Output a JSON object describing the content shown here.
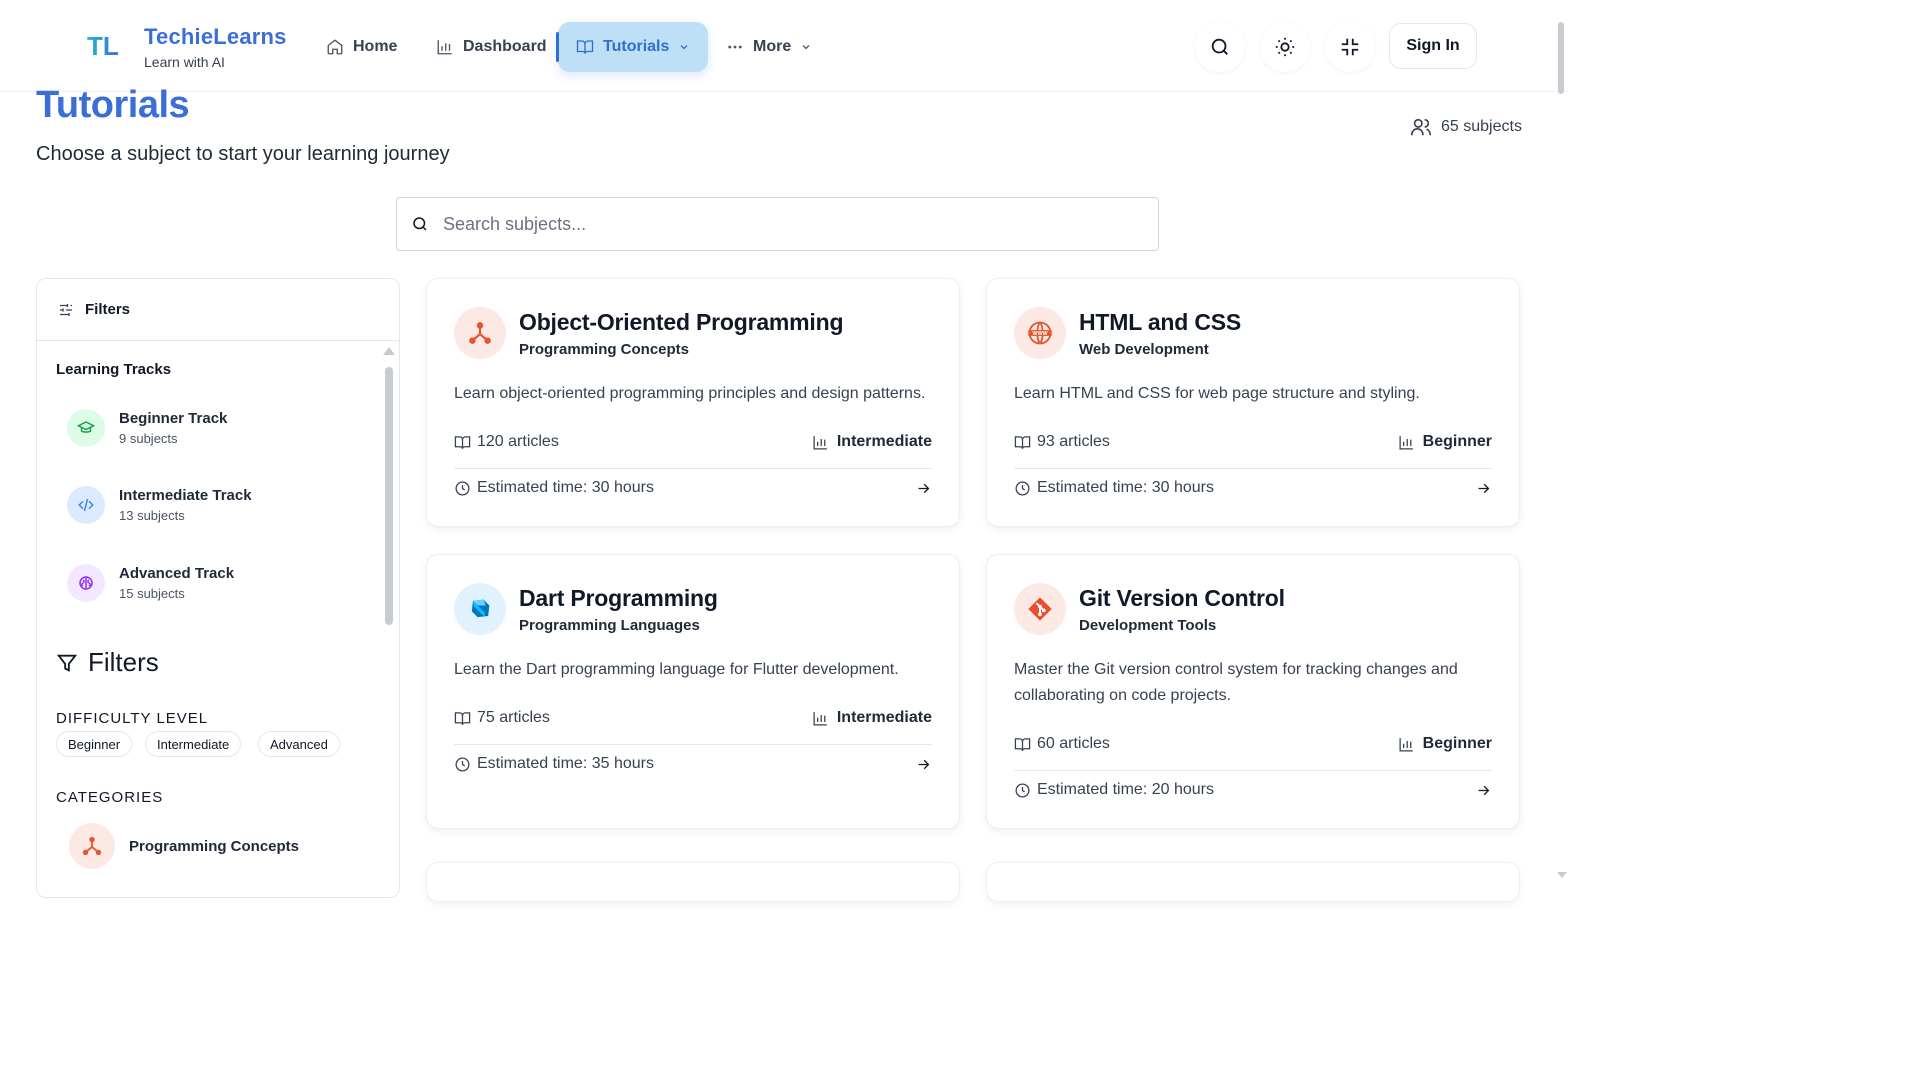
{
  "brand": {
    "mark": "TL",
    "name": "TechieLearns",
    "tagline": "Learn with AI"
  },
  "nav": {
    "home": "Home",
    "dashboard": "Dashboard",
    "tutorials": "Tutorials",
    "more": "More"
  },
  "header": {
    "sign_in": "Sign In"
  },
  "page": {
    "title": "Tutorials",
    "subtitle": "Choose a subject to start your learning journey",
    "subject_count": "65 subjects"
  },
  "search": {
    "placeholder": "Search subjects...",
    "value": ""
  },
  "sidebar": {
    "header": "Filters",
    "tracks_title": "Learning Tracks",
    "tracks": [
      {
        "name": "Beginner Track",
        "count": "9 subjects",
        "icon": "graduation-cap-icon",
        "color": "#16a34a",
        "bg": "#dcfce7"
      },
      {
        "name": "Intermediate Track",
        "count": "13 subjects",
        "icon": "code-icon",
        "color": "#3b82f6",
        "bg": "#dbeafe"
      },
      {
        "name": "Advanced Track",
        "count": "15 subjects",
        "icon": "brain-icon",
        "color": "#9333ea",
        "bg": "#f3e8ff"
      }
    ],
    "filters_title": "Filters",
    "difficulty_label": "DIFFICULTY LEVEL",
    "difficulty_options": [
      "Beginner",
      "Intermediate",
      "Advanced"
    ],
    "categories_label": "CATEGORIES",
    "categories": [
      {
        "name": "Programming Concepts",
        "icon": "network-icon"
      }
    ]
  },
  "cards": [
    {
      "title": "Object-Oriented Programming",
      "category": "Programming Concepts",
      "description": "Learn object-oriented programming principles and design patterns.",
      "articles": "120 articles",
      "level": "Intermediate",
      "time": "Estimated time: 30 hours",
      "icon": "network-icon",
      "icon_bg": "#fde9e3",
      "icon_color": "#e4572e"
    },
    {
      "title": "HTML and CSS",
      "category": "Web Development",
      "description": "Learn HTML and CSS for web page structure and styling.",
      "articles": "93 articles",
      "level": "Beginner",
      "time": "Estimated time: 30 hours",
      "icon": "www-globe-icon",
      "icon_bg": "#fde9e3",
      "icon_color": "#e4572e"
    },
    {
      "title": "Dart Programming",
      "category": "Programming Languages",
      "description": "Learn the Dart programming language for Flutter development.",
      "articles": "75 articles",
      "level": "Intermediate",
      "time": "Estimated time: 35 hours",
      "icon": "dart-logo-icon",
      "icon_bg": "#e0f2fe",
      "icon_color": "#0175c2"
    },
    {
      "title": "Git Version Control",
      "category": "Development Tools",
      "description": "Master the Git version control system for tracking changes and collaborating on code projects.",
      "articles": "60 articles",
      "level": "Beginner",
      "time": "Estimated time: 20 hours",
      "icon": "git-logo-icon",
      "icon_bg": "#fde9e3",
      "icon_color": "#e84e31"
    }
  ],
  "colors": {
    "accent": "#3b6fd8",
    "active_nav_bg": "#bfdff7"
  }
}
